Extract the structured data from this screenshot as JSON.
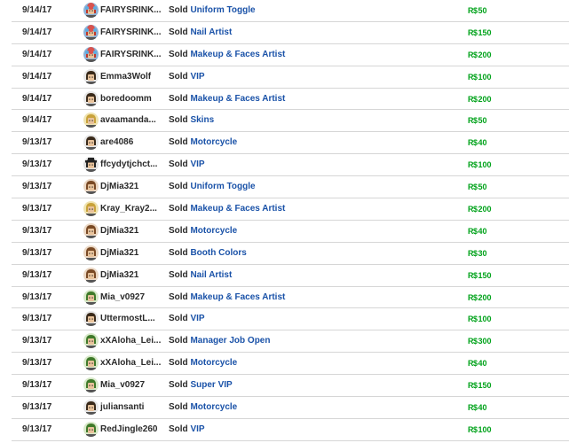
{
  "labels": {
    "sold": "Sold",
    "currency_symbol": "R$"
  },
  "colors": {
    "item_link": "#1a52a8",
    "amount": "#00a21a",
    "text": "#2a2a2a",
    "divider": "#d6d6d6"
  },
  "rows": [
    {
      "date": "9/14/17",
      "user": "FAIRYSRINK...",
      "item": "Uniform Toggle",
      "amount": "50",
      "avatar": "avatar-headdress-icon"
    },
    {
      "date": "9/14/17",
      "user": "FAIRYSRINK...",
      "item": "Nail Artist",
      "amount": "150",
      "avatar": "avatar-headdress-icon"
    },
    {
      "date": "9/14/17",
      "user": "FAIRYSRINK...",
      "item": "Makeup & Faces Artist",
      "amount": "200",
      "avatar": "avatar-headdress-icon"
    },
    {
      "date": "9/14/17",
      "user": "Emma3Wolf",
      "item": "VIP",
      "amount": "100",
      "avatar": "avatar-dark-hair-icon"
    },
    {
      "date": "9/14/17",
      "user": "boredoomm",
      "item": "Makeup & Faces Artist",
      "amount": "200",
      "avatar": "avatar-dark-hair-icon"
    },
    {
      "date": "9/14/17",
      "user": "avaamanda...",
      "item": "Skins",
      "amount": "50",
      "avatar": "avatar-yellow-icon"
    },
    {
      "date": "9/13/17",
      "user": "are4086",
      "item": "Motorcycle",
      "amount": "40",
      "avatar": "avatar-dark-hair-icon"
    },
    {
      "date": "9/13/17",
      "user": "ffcydytjchct...",
      "item": "VIP",
      "amount": "100",
      "avatar": "avatar-hat-icon"
    },
    {
      "date": "9/13/17",
      "user": "DjMia321",
      "item": "Uniform Toggle",
      "amount": "50",
      "avatar": "avatar-brown-hair-icon"
    },
    {
      "date": "9/13/17",
      "user": "Kray_Kray2...",
      "item": "Makeup & Faces Artist",
      "amount": "200",
      "avatar": "avatar-yellow-icon"
    },
    {
      "date": "9/13/17",
      "user": "DjMia321",
      "item": "Motorcycle",
      "amount": "40",
      "avatar": "avatar-brown-hair-icon"
    },
    {
      "date": "9/13/17",
      "user": "DjMia321",
      "item": "Booth Colors",
      "amount": "30",
      "avatar": "avatar-brown-hair-icon"
    },
    {
      "date": "9/13/17",
      "user": "DjMia321",
      "item": "Nail Artist",
      "amount": "150",
      "avatar": "avatar-brown-hair-icon"
    },
    {
      "date": "9/13/17",
      "user": "Mia_v0927",
      "item": "Makeup & Faces Artist",
      "amount": "200",
      "avatar": "avatar-green-hair-icon"
    },
    {
      "date": "9/13/17",
      "user": "UttermostL...",
      "item": "VIP",
      "amount": "100",
      "avatar": "avatar-dark-hair-icon"
    },
    {
      "date": "9/13/17",
      "user": "xXAloha_Lei...",
      "item": "Manager Job Open",
      "amount": "300",
      "avatar": "avatar-green-hair-icon"
    },
    {
      "date": "9/13/17",
      "user": "xXAloha_Lei...",
      "item": "Motorcycle",
      "amount": "40",
      "avatar": "avatar-green-hair-icon"
    },
    {
      "date": "9/13/17",
      "user": "Mia_v0927",
      "item": "Super VIP",
      "amount": "150",
      "avatar": "avatar-green-hair-icon"
    },
    {
      "date": "9/13/17",
      "user": "juliansanti",
      "item": "Motorcycle",
      "amount": "40",
      "avatar": "avatar-dark-hair-icon"
    },
    {
      "date": "9/13/17",
      "user": "RedJingle260",
      "item": "VIP",
      "amount": "100",
      "avatar": "avatar-green-hair-icon"
    }
  ]
}
